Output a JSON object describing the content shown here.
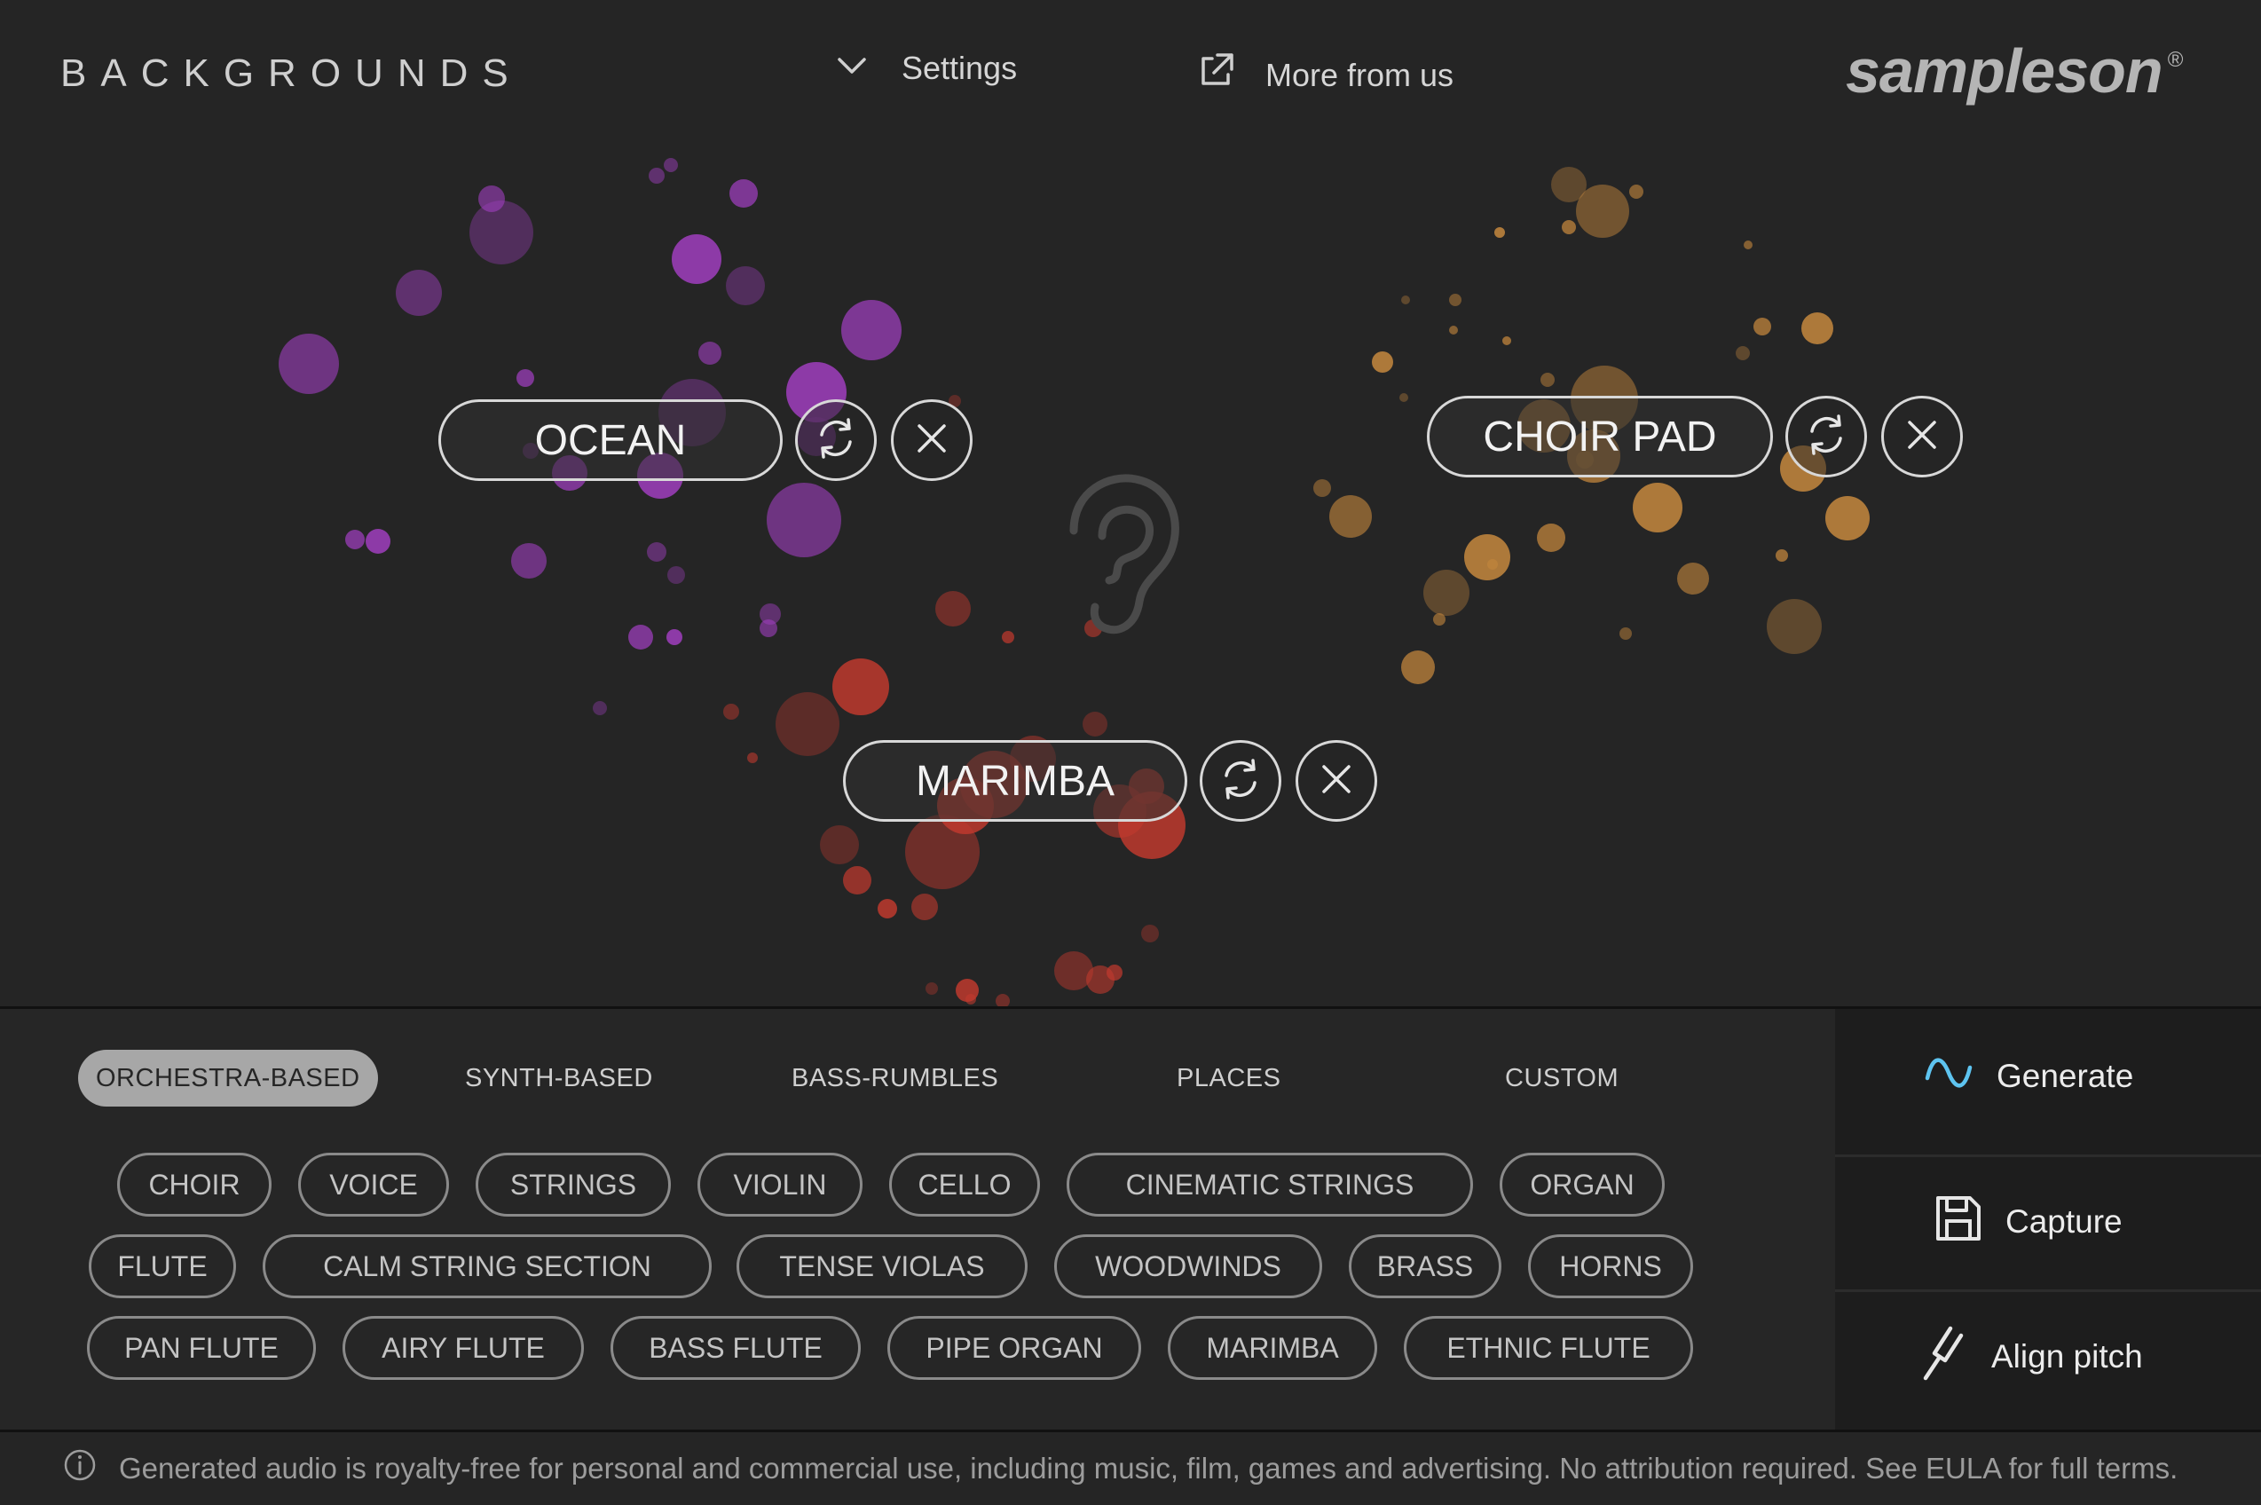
{
  "header": {
    "title": "BACKGROUNDS",
    "settings_label": "Settings",
    "more_label": "More from us",
    "logo_text": "sampleson",
    "logo_mark": "®"
  },
  "layers": [
    {
      "label": "OCEAN",
      "color": "#a23fc2",
      "refresh_icon": "refresh-icon",
      "remove_icon": "close-icon"
    },
    {
      "label": "CHOIR PAD",
      "color": "#c98a3e",
      "refresh_icon": "refresh-icon",
      "remove_icon": "close-icon"
    },
    {
      "label": "MARIMBA",
      "color": "#c23a2e",
      "refresh_icon": "refresh-icon",
      "remove_icon": "close-icon"
    }
  ],
  "categories": [
    "ORCHESTRA-BASED",
    "SYNTH-BASED",
    "BASS-RUMBLES",
    "PLACES",
    "CUSTOM"
  ],
  "active_category": "ORCHESTRA-BASED",
  "sounds": [
    [
      "CHOIR",
      "VOICE",
      "STRINGS",
      "VIOLIN",
      "CELLO",
      "CINEMATIC STRINGS",
      "ORGAN"
    ],
    [
      "FLUTE",
      "CALM STRING SECTION",
      "TENSE VIOLAS",
      "WOODWINDS",
      "BRASS",
      "HORNS"
    ],
    [
      "PAN FLUTE",
      "AIRY FLUTE",
      "BASS FLUTE",
      "PIPE ORGAN",
      "MARIMBA",
      "ETHNIC FLUTE"
    ]
  ],
  "actions": {
    "generate": "Generate",
    "capture": "Capture",
    "align_pitch": "Align pitch",
    "accent": "#5ec4f0"
  },
  "footer": {
    "notice": "Generated audio is royalty-free for personal and commercial use, including music, film, games and advertising. No attribution required. See EULA for full terms."
  }
}
